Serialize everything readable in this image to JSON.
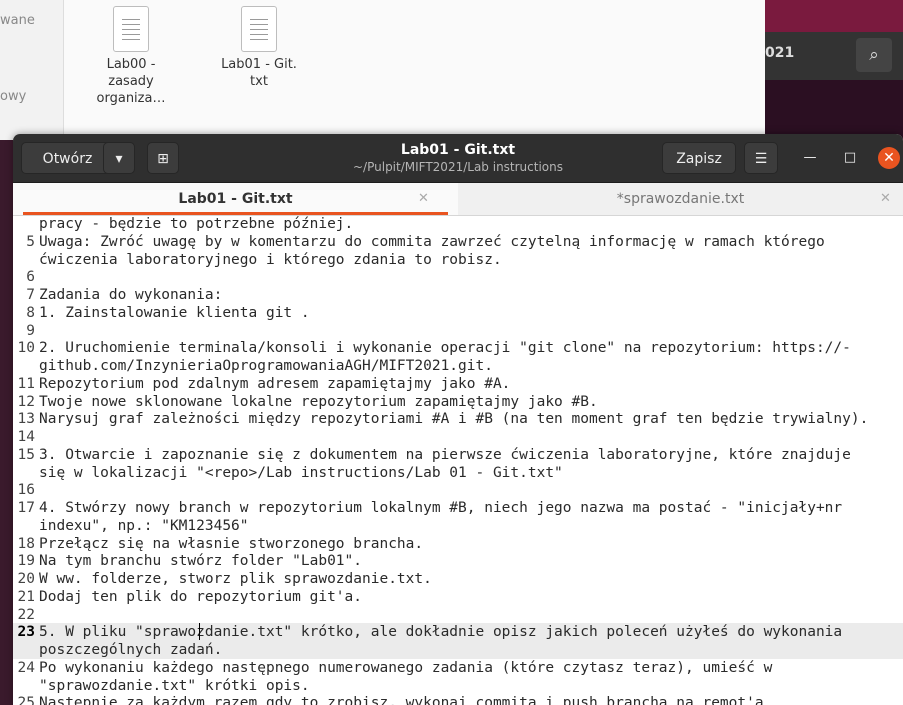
{
  "file_manager": {
    "sidebar_top": "wane",
    "sidebar_mid": "owy",
    "files": [
      {
        "name_lines": [
          "Lab00 -",
          "zasady",
          "organiza…"
        ]
      },
      {
        "name_lines": [
          "Lab01 - Git.",
          "txt"
        ]
      }
    ]
  },
  "background_window": {
    "label": "021"
  },
  "gedit": {
    "open_label": "Otwórz",
    "save_label": "Zapisz",
    "title": "Lab01 - Git.txt",
    "subtitle": "~/Pulpit/MIFT2021/Lab instructions",
    "tabs": [
      {
        "label": "Lab01 - Git.txt",
        "active": true
      },
      {
        "label": "*sprawozdanie.txt",
        "active": false
      }
    ],
    "lines": [
      {
        "n": "",
        "t": "pracy - będzie to potrzebne później."
      },
      {
        "n": "5",
        "t": "Uwaga: Zwróć uwagę by w komentarzu do commita zawrzeć czytelną informację w ramach którego"
      },
      {
        "n": "",
        "t": "ćwiczenia laboratoryjnego i którego zdania to robisz."
      },
      {
        "n": "6",
        "t": ""
      },
      {
        "n": "7",
        "t": "Zadania do wykonania:"
      },
      {
        "n": "8",
        "t": "1. Zainstalowanie klienta git ."
      },
      {
        "n": "9",
        "t": ""
      },
      {
        "n": "10",
        "t": "2. Uruchomienie terminala/konsoli i wykonanie operacji \"git clone\" na repozytorium: https://-"
      },
      {
        "n": "",
        "t": "github.com/InzynieriaOprogramowaniaAGH/MIFT2021.git."
      },
      {
        "n": "11",
        "t": "Repozytorium pod zdalnym adresem zapamiętajmy jako #A."
      },
      {
        "n": "12",
        "t": "Twoje nowe sklonowane lokalne repozytorium zapamiętajmy jako #B."
      },
      {
        "n": "13",
        "t": "Narysuj graf zależności między repozytoriami #A i #B (na ten moment graf ten będzie trywialny)."
      },
      {
        "n": "14",
        "t": ""
      },
      {
        "n": "15",
        "t": "3. Otwarcie i zapoznanie się z dokumentem na pierwsze ćwiczenia laboratoryjne, które znajduje"
      },
      {
        "n": "",
        "t": "się w lokalizacji \"<repo>/Lab instructions/Lab 01 - Git.txt\""
      },
      {
        "n": "16",
        "t": ""
      },
      {
        "n": "17",
        "t": "4. Stwórzy nowy branch w repozytorium lokalnym #B, niech jego nazwa ma postać - \"inicjały+nr"
      },
      {
        "n": "",
        "t": "indexu\", np.: \"KM123456\""
      },
      {
        "n": "18",
        "t": "Przełącz się na własnie stworzonego brancha."
      },
      {
        "n": "19",
        "t": "Na tym branchu stwórz folder \"Lab01\"."
      },
      {
        "n": "20",
        "t": "W ww. folderze, stworz plik sprawozdanie.txt."
      },
      {
        "n": "21",
        "t": "Dodaj ten plik do repozytorium git'a."
      },
      {
        "n": "22",
        "t": ""
      },
      {
        "n": "23",
        "t": "5. W pliku \"sprawozdanie.txt\" krótko, ale dokładnie opisz jakich poleceń użyłeś do wykonania",
        "current": true
      },
      {
        "n": "",
        "t": "poszczególnych zadań.",
        "current": true
      },
      {
        "n": "24",
        "t": "Po wykonaniu każdego następnego numerowanego zadania (które czytasz teraz), umieść w"
      },
      {
        "n": "",
        "t": "\"sprawozdanie.txt\" krótki opis."
      },
      {
        "n": "25",
        "t": "Następnie za każdym razem gdy to zrobisz, wykonaj commita i push brancha na remot'a"
      }
    ]
  }
}
